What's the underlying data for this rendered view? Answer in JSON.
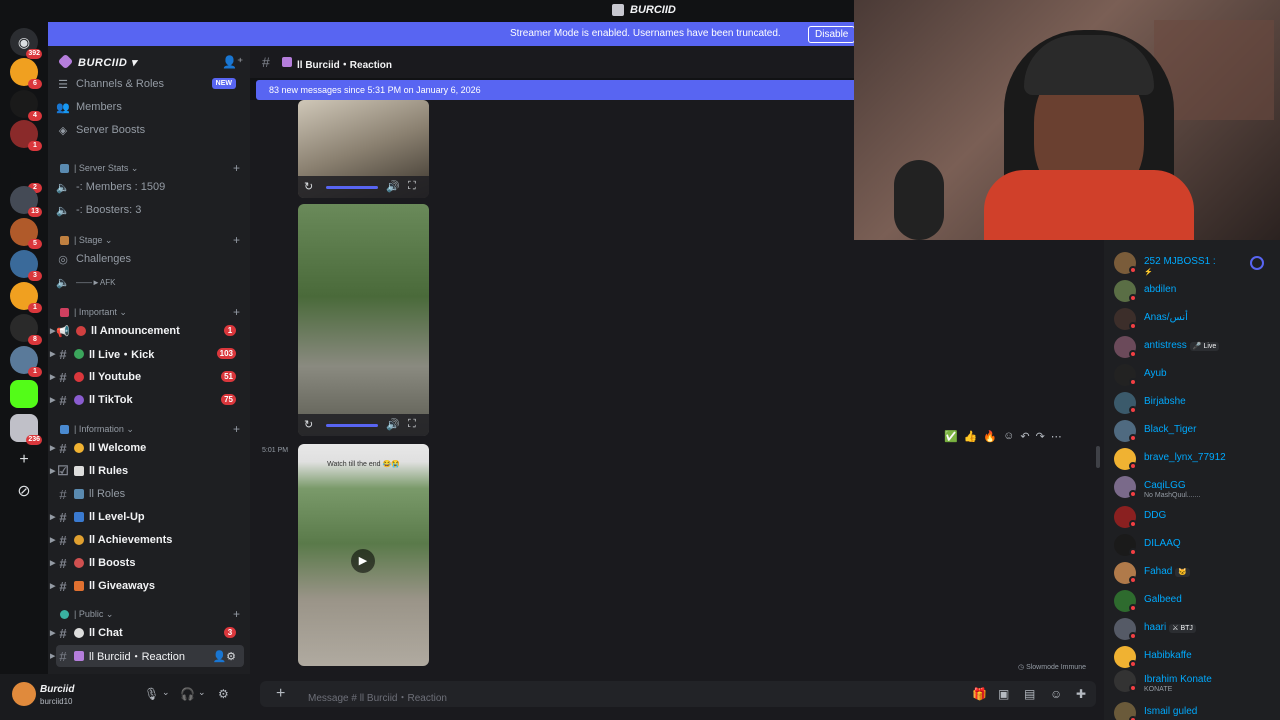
{
  "window": {
    "title": "BURCIID"
  },
  "banner": {
    "message": "Streamer Mode is enabled. Usernames have been truncated.",
    "disable_label": "Disable"
  },
  "rail": {
    "badges": [
      "392",
      "6",
      "4",
      "1",
      "2",
      "13",
      "5",
      "3",
      "1",
      "8",
      "1",
      "236"
    ]
  },
  "server": {
    "name": "BURCIID"
  },
  "sidebar": {
    "top_items": [
      {
        "label": "Channels & Roles",
        "badge": "NEW"
      },
      {
        "label": "Members"
      },
      {
        "label": "Server Boosts"
      }
    ],
    "categories": {
      "stats": "| Server Stats",
      "stage": "| Stage",
      "important": "| Important",
      "information": "| Information",
      "public": "| Public"
    },
    "stats": {
      "members": "-: Members : 1509",
      "boosters": "-: Boosters: 3"
    },
    "stage": {
      "challenges": "Challenges",
      "afk": "——►AFK"
    },
    "important": [
      {
        "label": "ll Announcement",
        "badge": "1"
      },
      {
        "label": "ll Live・Kick",
        "badge": "103"
      },
      {
        "label": "ll Youtube",
        "badge": "51"
      },
      {
        "label": "ll TikTok",
        "badge": "75"
      }
    ],
    "information": [
      {
        "label": "ll Welcome"
      },
      {
        "label": "ll Rules"
      },
      {
        "label": "ll Roles"
      },
      {
        "label": "ll Level-Up"
      },
      {
        "label": "ll Achievements"
      },
      {
        "label": "ll Boosts"
      },
      {
        "label": "ll Giveaways"
      }
    ],
    "public": [
      {
        "label": "ll Chat",
        "badge": "3"
      },
      {
        "label": "ll Burciid・Reaction"
      }
    ]
  },
  "user": {
    "name": "Burciid",
    "status": "burciid10"
  },
  "chat": {
    "channel_title": "ll Burciid・Reaction",
    "new_messages": "83 new messages since 5:31 PM on January 6, 2026",
    "timestamp": "5:01 PM",
    "video_caption": "Watch till the end 😂😭",
    "slowmode": "Slowmode Immune",
    "placeholder": "Message # ll Burciid・Reaction"
  },
  "members": [
    {
      "name": "252 MJBOSS1 :",
      "sub": "⚡",
      "color": "#7a5c3a"
    },
    {
      "name": "abdilen",
      "color": "#5a6e45"
    },
    {
      "name": "Anas/أنس",
      "color": "#3c2e2a"
    },
    {
      "name": "antistress",
      "tag": "🎤 Live",
      "color": "#6b4a5a"
    },
    {
      "name": "Ayub",
      "color": "#222222"
    },
    {
      "name": "Birjabshe",
      "color": "#3b5a6b"
    },
    {
      "name": "Black_Tiger",
      "color": "#4f6a80"
    },
    {
      "name": "brave_lynx_77912",
      "color": "#f0b232"
    },
    {
      "name": "CaqiLGG",
      "sub": "No MashQuul.......",
      "color": "#7a6a8a"
    },
    {
      "name": "DDG",
      "color": "#8a2020"
    },
    {
      "name": "DILAAQ",
      "color": "#1a1a1a"
    },
    {
      "name": "Fahad",
      "tag": "🐱",
      "color": "#b07a4a"
    },
    {
      "name": "Galbeed",
      "color": "#2e6b2e"
    },
    {
      "name": "haari",
      "tag": "⚔ BTJ",
      "color": "#555a66"
    },
    {
      "name": "Habibkaffe",
      "color": "#f0b232"
    },
    {
      "name": "Ibrahim Konate",
      "sub": "KONATE",
      "color": "#333"
    },
    {
      "name": "Ismail guled",
      "color": "#6a5a3a"
    }
  ]
}
